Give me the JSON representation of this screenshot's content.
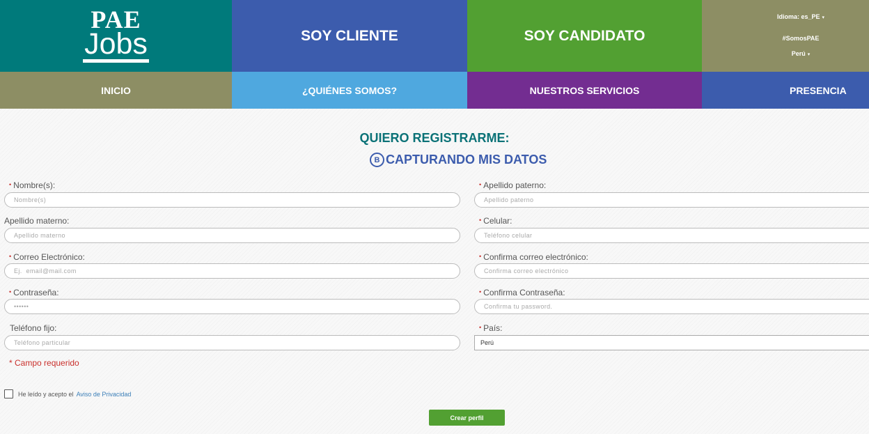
{
  "header": {
    "logo_top": "PAE",
    "logo_bottom": "Jobs",
    "cliente": "SOY CLIENTE",
    "candidato": "SOY CANDIDATO",
    "idioma": "Idioma: es_PE",
    "hashtag": "#SomosPAE",
    "country": "Perú",
    "caret": "▾"
  },
  "nav": {
    "inicio": "INICIO",
    "quienes": "¿QUIÉNES SOMOS?",
    "servicios": "NUESTROS SERVICIOS",
    "presencia": "PRESENCIA"
  },
  "form": {
    "title": "QUIERO REGISTRARME:",
    "step_letter": "B",
    "subtitle": "CAPTURANDO MIS DATOS",
    "required_mark": "•",
    "fields": {
      "nombre": {
        "label": "Nombre(s):",
        "placeholder": "Nombre(s)"
      },
      "apellido_paterno": {
        "label": "Apellido paterno:",
        "placeholder": "Apellido paterno"
      },
      "apellido_materno": {
        "label": "Apellido materno:",
        "placeholder": "Apellido materno"
      },
      "celular": {
        "label": "Celular:",
        "placeholder": "Teléfono celular"
      },
      "correo": {
        "label": "Correo Electrónico:",
        "placeholder": "Ej.  email@mail.com"
      },
      "confirma_correo": {
        "label": "Confirma correo electrónico:",
        "placeholder": "Confirma correo electrónico"
      },
      "contrasena": {
        "label": "Contraseña:",
        "placeholder": "••••••"
      },
      "confirma_contrasena": {
        "label": "Confirma Contraseña:",
        "placeholder": "Confirma tu password."
      },
      "telefono_fijo": {
        "label": "Teléfono fijo:",
        "placeholder": "Teléfono particular"
      },
      "pais": {
        "label": "País:",
        "value": "Perú"
      }
    },
    "required_note": "* Campo requerido",
    "accept_text": "He leído y acepto el",
    "privacy_link": "Aviso de Privacidad",
    "submit": "Crear perfil"
  },
  "colors": {
    "teal": "#007a7b",
    "blue": "#3c5cad",
    "green": "#52a032",
    "olive": "#8d8e64",
    "light_blue": "#4fa8df",
    "purple": "#732d91",
    "required_red": "#c9302c"
  }
}
